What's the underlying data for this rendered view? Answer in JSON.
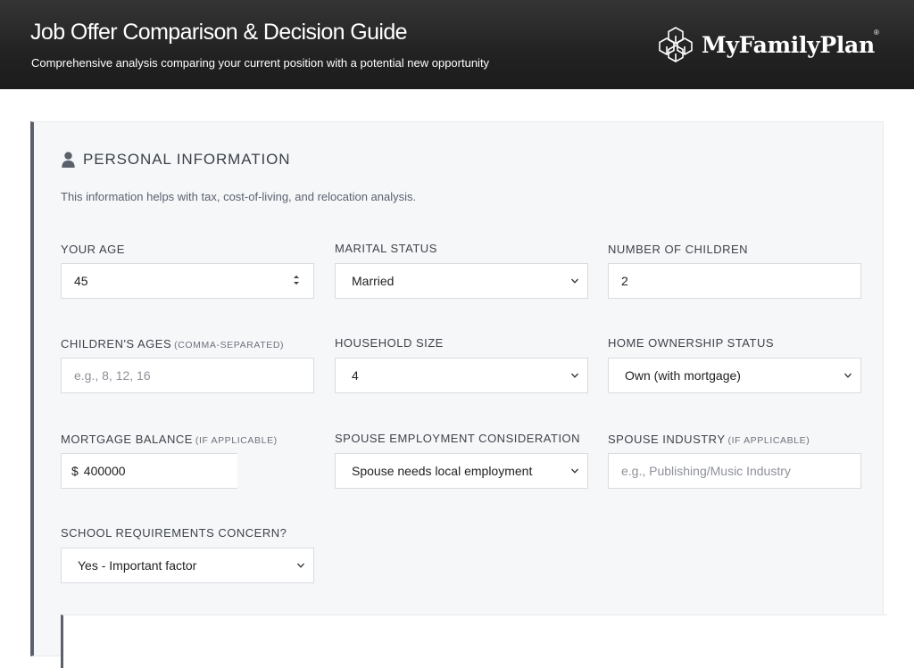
{
  "header": {
    "title": "Job Offer Comparison & Decision Guide",
    "subtitle": "Comprehensive analysis comparing your current position with a potential new opportunity",
    "logo_text": "MyFamilyPlan",
    "logo_reg": "®"
  },
  "section": {
    "icon": "person-icon",
    "title": "PERSONAL INFORMATION",
    "description": "This information helps with tax, cost-of-living, and relocation analysis."
  },
  "fields": {
    "age": {
      "label": "YOUR AGE",
      "value": "45"
    },
    "marital": {
      "label": "MARITAL STATUS",
      "value": "Married"
    },
    "children": {
      "label": "NUMBER OF CHILDREN",
      "value": "2"
    },
    "children_ages": {
      "label": "CHILDREN'S AGES",
      "hint": "(COMMA-SEPARATED)",
      "placeholder": "e.g., 8, 12, 16"
    },
    "household": {
      "label": "HOUSEHOLD SIZE",
      "value": "4"
    },
    "home": {
      "label": "HOME OWNERSHIP STATUS",
      "value": "Own (with mortgage)"
    },
    "mortgage": {
      "label": "MORTGAGE BALANCE",
      "hint": "(IF APPLICABLE)",
      "currency": "$",
      "value": "400000"
    },
    "spouse_emp": {
      "label": "SPOUSE EMPLOYMENT CONSIDERATION",
      "value": "Spouse needs local employment"
    },
    "spouse_ind": {
      "label": "SPOUSE INDUSTRY",
      "hint": "(IF APPLICABLE)",
      "placeholder": "e.g., Publishing/Music Industry"
    },
    "school": {
      "label": "SCHOOL REQUIREMENTS CONCERN?",
      "value": "Yes - Important factor"
    }
  },
  "colors": {
    "header_bg": "#222222",
    "card_bg": "#f6f7f9",
    "accent_border": "#5b616a"
  }
}
